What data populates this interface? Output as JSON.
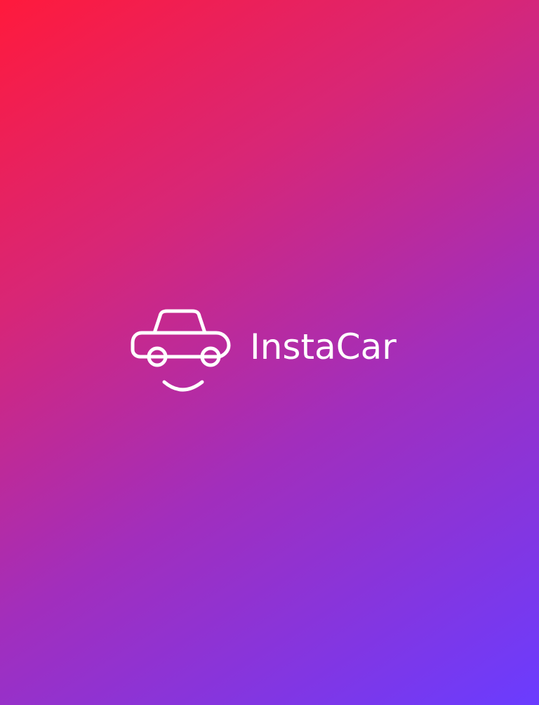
{
  "app": {
    "brand_name": "InstaCar"
  },
  "icons": {
    "logo": "smiling-car-icon"
  },
  "colors": {
    "gradient_start": "#ff1a3c",
    "gradient_mid": "#a22ebc",
    "gradient_end": "#6a3cff",
    "logo": "#ffffff"
  }
}
